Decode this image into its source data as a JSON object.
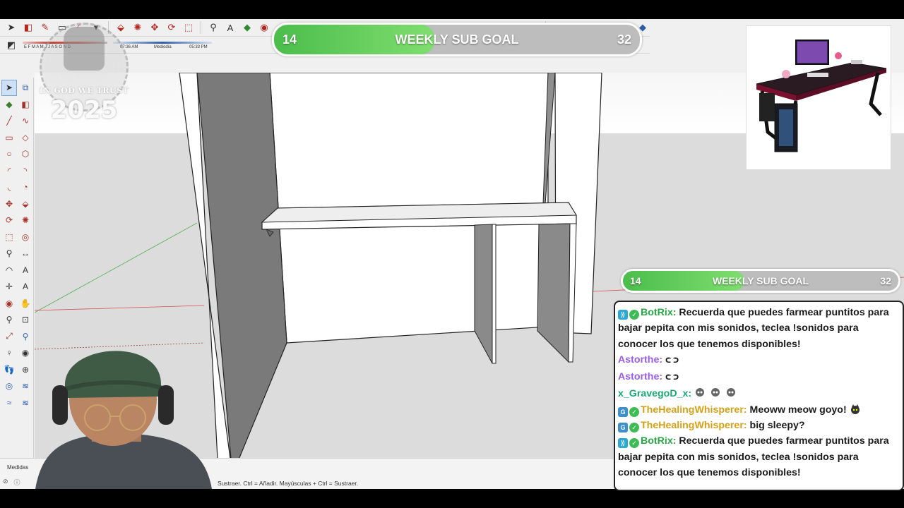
{
  "app": {
    "measurements_label": "Medidas",
    "status_text": "Sustraer. Ctrl = Añadir. Mayúsculas + Ctrl = Sustraer.",
    "shadow_time_1": "07:36 AM",
    "shadow_time_2": "05:33 PM",
    "shadow_mid_label": "Mediodía",
    "shadow_months": "E F M A M J J A S O N D"
  },
  "watermark": {
    "line1": "IN GOD WE TRUST",
    "line2": "2025"
  },
  "sub_goal_top": {
    "current": "14",
    "label": "WEEKLY SUB GOAL",
    "target": "32",
    "progress": 0.44
  },
  "sub_goal_side": {
    "current": "14",
    "label": "WEEKLY SUB GOAL",
    "target": "32",
    "progress": 0.44
  },
  "chat": {
    "messages": [
      {
        "user": "BotRix",
        "color": "#28a745",
        "badges": [
          "bot",
          "ver"
        ],
        "text": "Recuerda que puedes farmear puntitos para bajar pepita con mis sonidos, teclea !sonidos para conocer los que tenemos disponibles!"
      },
      {
        "user": "Astorthe",
        "color": "#9b5de5",
        "badges": [],
        "text": "ᕦ ᕤ"
      },
      {
        "user": "Astorthe",
        "color": "#9b5de5",
        "badges": [],
        "text": "ᕦ ᕤ"
      },
      {
        "user": "x_GravegoD_x",
        "color": "#19a974",
        "badges": [],
        "text": ""
      },
      {
        "user": "TheHealingWhisperer",
        "color": "#d4a017",
        "badges": [
          "sub",
          "ver"
        ],
        "text": "Meoww meow goyo!"
      },
      {
        "user": "TheHealingWhisperer",
        "color": "#d4a017",
        "badges": [
          "sub",
          "ver"
        ],
        "text": "big sleepy?"
      },
      {
        "user": "BotRix",
        "color": "#28a745",
        "badges": [
          "bot",
          "ver"
        ],
        "text": "Recuerda que puedes farmear puntitos para bajar pepita con mis sonidos, teclea !sonidos para conocer los que tenemos disponibles!"
      }
    ]
  }
}
